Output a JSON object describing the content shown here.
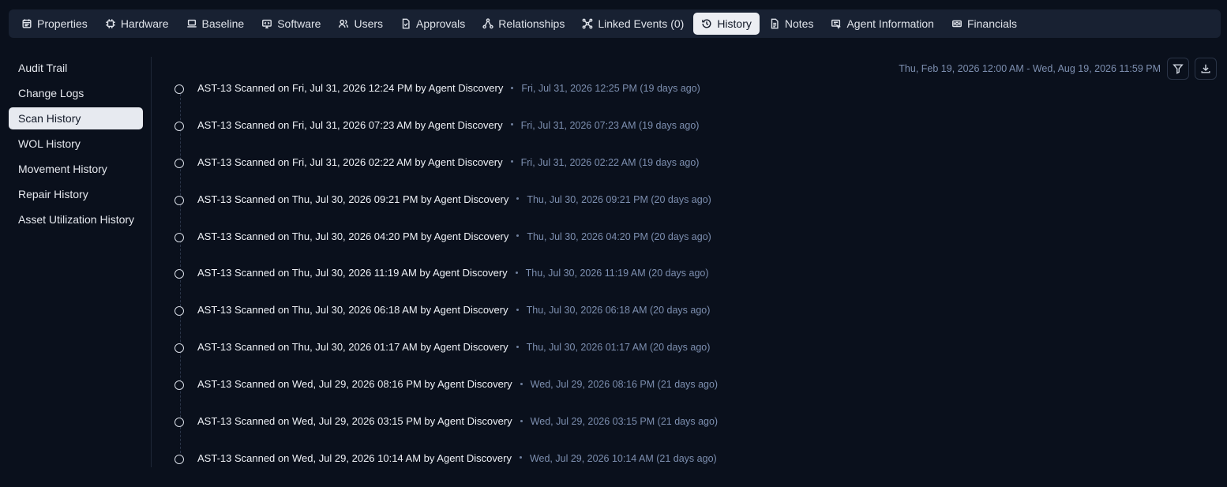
{
  "tabs": [
    {
      "label": "Properties",
      "icon": "calendar-icon"
    },
    {
      "label": "Hardware",
      "icon": "chip-icon"
    },
    {
      "label": "Baseline",
      "icon": "laptop-icon"
    },
    {
      "label": "Software",
      "icon": "software-icon"
    },
    {
      "label": "Users",
      "icon": "users-icon"
    },
    {
      "label": "Approvals",
      "icon": "approval-icon"
    },
    {
      "label": "Relationships",
      "icon": "relationships-icon"
    },
    {
      "label": "Linked Events (0)",
      "icon": "linked-events-icon"
    },
    {
      "label": "History",
      "icon": "history-icon",
      "active": true
    },
    {
      "label": "Notes",
      "icon": "notes-icon"
    },
    {
      "label": "Agent Information",
      "icon": "agent-icon"
    },
    {
      "label": "Financials",
      "icon": "money-icon"
    }
  ],
  "sidebar": {
    "items": [
      {
        "label": "Audit Trail"
      },
      {
        "label": "Change Logs"
      },
      {
        "label": "Scan History",
        "active": true
      },
      {
        "label": "WOL History"
      },
      {
        "label": "Movement History"
      },
      {
        "label": "Repair History"
      },
      {
        "label": "Asset Utilization History"
      }
    ]
  },
  "date_range": "Thu, Feb 19, 2026 12:00 AM - Wed, Aug 19, 2026 11:59 PM",
  "toolbar": {
    "filter_icon": "filter-icon",
    "download_icon": "download-icon"
  },
  "entries": [
    {
      "text": "AST-13 Scanned on Fri, Jul 31, 2026 12:24 PM by Agent Discovery",
      "meta": "Fri, Jul 31, 2026 12:25 PM (19 days ago)"
    },
    {
      "text": "AST-13 Scanned on Fri, Jul 31, 2026 07:23 AM by Agent Discovery",
      "meta": "Fri, Jul 31, 2026 07:23 AM (19 days ago)"
    },
    {
      "text": "AST-13 Scanned on Fri, Jul 31, 2026 02:22 AM by Agent Discovery",
      "meta": "Fri, Jul 31, 2026 02:22 AM (19 days ago)"
    },
    {
      "text": "AST-13 Scanned on Thu, Jul 30, 2026 09:21 PM by Agent Discovery",
      "meta": "Thu, Jul 30, 2026 09:21 PM (20 days ago)"
    },
    {
      "text": "AST-13 Scanned on Thu, Jul 30, 2026 04:20 PM by Agent Discovery",
      "meta": "Thu, Jul 30, 2026 04:20 PM (20 days ago)"
    },
    {
      "text": "AST-13 Scanned on Thu, Jul 30, 2026 11:19 AM by Agent Discovery",
      "meta": "Thu, Jul 30, 2026 11:19 AM (20 days ago)"
    },
    {
      "text": "AST-13 Scanned on Thu, Jul 30, 2026 06:18 AM by Agent Discovery",
      "meta": "Thu, Jul 30, 2026 06:18 AM (20 days ago)"
    },
    {
      "text": "AST-13 Scanned on Thu, Jul 30, 2026 01:17 AM by Agent Discovery",
      "meta": "Thu, Jul 30, 2026 01:17 AM (20 days ago)"
    },
    {
      "text": "AST-13 Scanned on Wed, Jul 29, 2026 08:16 PM by Agent Discovery",
      "meta": "Wed, Jul 29, 2026 08:16 PM (21 days ago)"
    },
    {
      "text": "AST-13 Scanned on Wed, Jul 29, 2026 03:15 PM by Agent Discovery",
      "meta": "Wed, Jul 29, 2026 03:15 PM (21 days ago)"
    },
    {
      "text": "AST-13 Scanned on Wed, Jul 29, 2026 10:14 AM by Agent Discovery",
      "meta": "Wed, Jul 29, 2026 10:14 AM (21 days ago)"
    }
  ]
}
